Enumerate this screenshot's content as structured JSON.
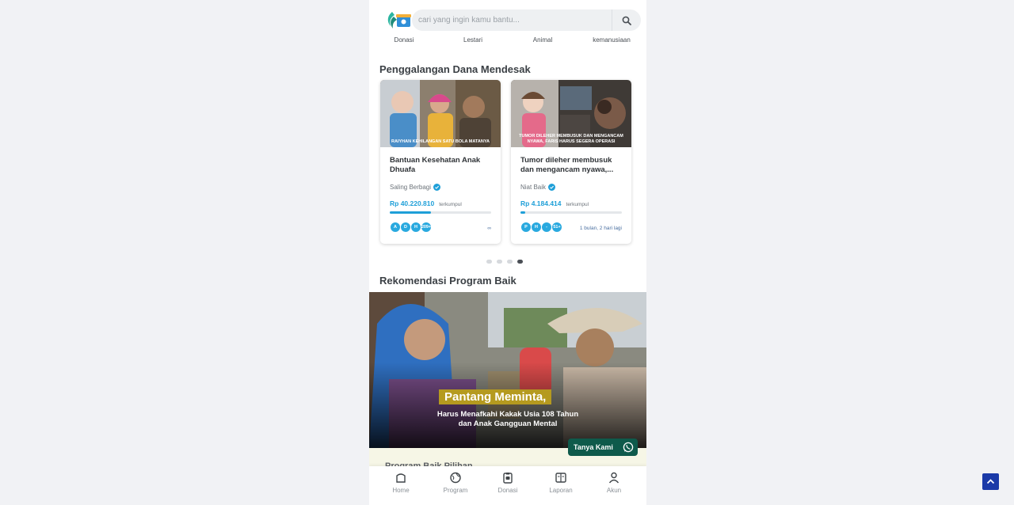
{
  "search": {
    "placeholder": "cari yang ingin kamu bantu..."
  },
  "categories": [
    "Donasi",
    "Lestari",
    "Animal",
    "kemanusiaan"
  ],
  "urgent": {
    "title": "Penggalangan Dana Mendesak",
    "cards": [
      {
        "image_caption": "RAIYHAN KEHILANGAN SATU BOLA MATANYA",
        "title": "Bantuan Kesehatan Anak Dhuafa",
        "org": "Saling Berbagi",
        "amount": "Rp 40.220.810",
        "collected_label": "terkumpul",
        "progress": 0.41,
        "donors": [
          "A",
          "D",
          "H",
          "209+"
        ],
        "meta": "∞"
      },
      {
        "image_caption": "TUMOR DILEHER MEMBUSUK DAN MENGANCAM NYAWA, FARIS HARUS SEGERA OPERASI",
        "title": "Tumor dileher membusuk dan mengancam nyawa,...",
        "org": "Niat Baik",
        "amount": "Rp 4.184.414",
        "collected_label": "terkumpul",
        "progress": 0.05,
        "donors": [
          "P",
          "H",
          "-",
          "51+"
        ],
        "meta": "1 bulan, 2 hari lagi"
      }
    ],
    "carousel_pages": 4,
    "carousel_active": 4
  },
  "recommend": {
    "title": "Rekomendasi Program Baik",
    "banner_headline": "Pantang Meminta,",
    "banner_sub1": "Harus Menafkahi Kakak Usia 108 Tahun",
    "banner_sub2": "dan Anak Gangguan Mental"
  },
  "whatsapp_label": "Tanya Kami",
  "next_section": "Program Baik Pilihan",
  "bottom_nav": [
    "Home",
    "Program",
    "Donasi",
    "Laporan",
    "Akun"
  ],
  "colors": {
    "accent": "#1e9fd8",
    "whatsapp": "#0e5a4b",
    "scroll_top": "#1b3aa8"
  }
}
